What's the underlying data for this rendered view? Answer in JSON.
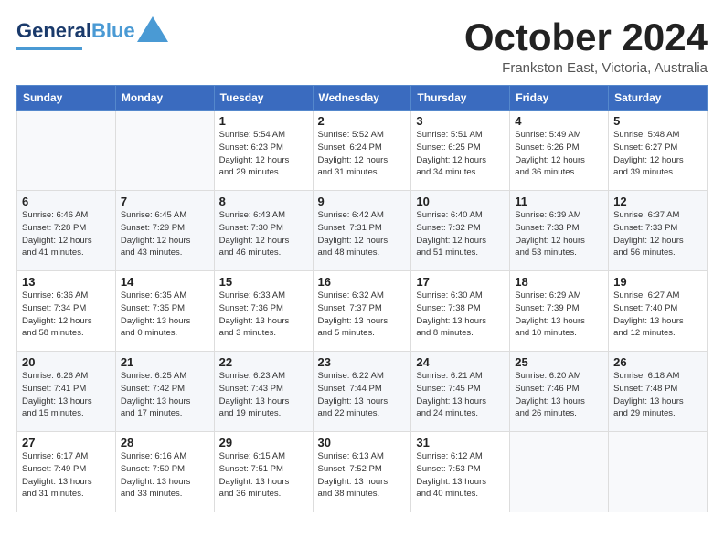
{
  "header": {
    "logo_line1": "General",
    "logo_line2": "Blue",
    "month": "October 2024",
    "location": "Frankston East, Victoria, Australia"
  },
  "weekdays": [
    "Sunday",
    "Monday",
    "Tuesday",
    "Wednesday",
    "Thursday",
    "Friday",
    "Saturday"
  ],
  "weeks": [
    [
      {
        "day": "",
        "info": ""
      },
      {
        "day": "",
        "info": ""
      },
      {
        "day": "1",
        "info": "Sunrise: 5:54 AM\nSunset: 6:23 PM\nDaylight: 12 hours\nand 29 minutes."
      },
      {
        "day": "2",
        "info": "Sunrise: 5:52 AM\nSunset: 6:24 PM\nDaylight: 12 hours\nand 31 minutes."
      },
      {
        "day": "3",
        "info": "Sunrise: 5:51 AM\nSunset: 6:25 PM\nDaylight: 12 hours\nand 34 minutes."
      },
      {
        "day": "4",
        "info": "Sunrise: 5:49 AM\nSunset: 6:26 PM\nDaylight: 12 hours\nand 36 minutes."
      },
      {
        "day": "5",
        "info": "Sunrise: 5:48 AM\nSunset: 6:27 PM\nDaylight: 12 hours\nand 39 minutes."
      }
    ],
    [
      {
        "day": "6",
        "info": "Sunrise: 6:46 AM\nSunset: 7:28 PM\nDaylight: 12 hours\nand 41 minutes."
      },
      {
        "day": "7",
        "info": "Sunrise: 6:45 AM\nSunset: 7:29 PM\nDaylight: 12 hours\nand 43 minutes."
      },
      {
        "day": "8",
        "info": "Sunrise: 6:43 AM\nSunset: 7:30 PM\nDaylight: 12 hours\nand 46 minutes."
      },
      {
        "day": "9",
        "info": "Sunrise: 6:42 AM\nSunset: 7:31 PM\nDaylight: 12 hours\nand 48 minutes."
      },
      {
        "day": "10",
        "info": "Sunrise: 6:40 AM\nSunset: 7:32 PM\nDaylight: 12 hours\nand 51 minutes."
      },
      {
        "day": "11",
        "info": "Sunrise: 6:39 AM\nSunset: 7:33 PM\nDaylight: 12 hours\nand 53 minutes."
      },
      {
        "day": "12",
        "info": "Sunrise: 6:37 AM\nSunset: 7:33 PM\nDaylight: 12 hours\nand 56 minutes."
      }
    ],
    [
      {
        "day": "13",
        "info": "Sunrise: 6:36 AM\nSunset: 7:34 PM\nDaylight: 12 hours\nand 58 minutes."
      },
      {
        "day": "14",
        "info": "Sunrise: 6:35 AM\nSunset: 7:35 PM\nDaylight: 13 hours\nand 0 minutes."
      },
      {
        "day": "15",
        "info": "Sunrise: 6:33 AM\nSunset: 7:36 PM\nDaylight: 13 hours\nand 3 minutes."
      },
      {
        "day": "16",
        "info": "Sunrise: 6:32 AM\nSunset: 7:37 PM\nDaylight: 13 hours\nand 5 minutes."
      },
      {
        "day": "17",
        "info": "Sunrise: 6:30 AM\nSunset: 7:38 PM\nDaylight: 13 hours\nand 8 minutes."
      },
      {
        "day": "18",
        "info": "Sunrise: 6:29 AM\nSunset: 7:39 PM\nDaylight: 13 hours\nand 10 minutes."
      },
      {
        "day": "19",
        "info": "Sunrise: 6:27 AM\nSunset: 7:40 PM\nDaylight: 13 hours\nand 12 minutes."
      }
    ],
    [
      {
        "day": "20",
        "info": "Sunrise: 6:26 AM\nSunset: 7:41 PM\nDaylight: 13 hours\nand 15 minutes."
      },
      {
        "day": "21",
        "info": "Sunrise: 6:25 AM\nSunset: 7:42 PM\nDaylight: 13 hours\nand 17 minutes."
      },
      {
        "day": "22",
        "info": "Sunrise: 6:23 AM\nSunset: 7:43 PM\nDaylight: 13 hours\nand 19 minutes."
      },
      {
        "day": "23",
        "info": "Sunrise: 6:22 AM\nSunset: 7:44 PM\nDaylight: 13 hours\nand 22 minutes."
      },
      {
        "day": "24",
        "info": "Sunrise: 6:21 AM\nSunset: 7:45 PM\nDaylight: 13 hours\nand 24 minutes."
      },
      {
        "day": "25",
        "info": "Sunrise: 6:20 AM\nSunset: 7:46 PM\nDaylight: 13 hours\nand 26 minutes."
      },
      {
        "day": "26",
        "info": "Sunrise: 6:18 AM\nSunset: 7:48 PM\nDaylight: 13 hours\nand 29 minutes."
      }
    ],
    [
      {
        "day": "27",
        "info": "Sunrise: 6:17 AM\nSunset: 7:49 PM\nDaylight: 13 hours\nand 31 minutes."
      },
      {
        "day": "28",
        "info": "Sunrise: 6:16 AM\nSunset: 7:50 PM\nDaylight: 13 hours\nand 33 minutes."
      },
      {
        "day": "29",
        "info": "Sunrise: 6:15 AM\nSunset: 7:51 PM\nDaylight: 13 hours\nand 36 minutes."
      },
      {
        "day": "30",
        "info": "Sunrise: 6:13 AM\nSunset: 7:52 PM\nDaylight: 13 hours\nand 38 minutes."
      },
      {
        "day": "31",
        "info": "Sunrise: 6:12 AM\nSunset: 7:53 PM\nDaylight: 13 hours\nand 40 minutes."
      },
      {
        "day": "",
        "info": ""
      },
      {
        "day": "",
        "info": ""
      }
    ]
  ]
}
